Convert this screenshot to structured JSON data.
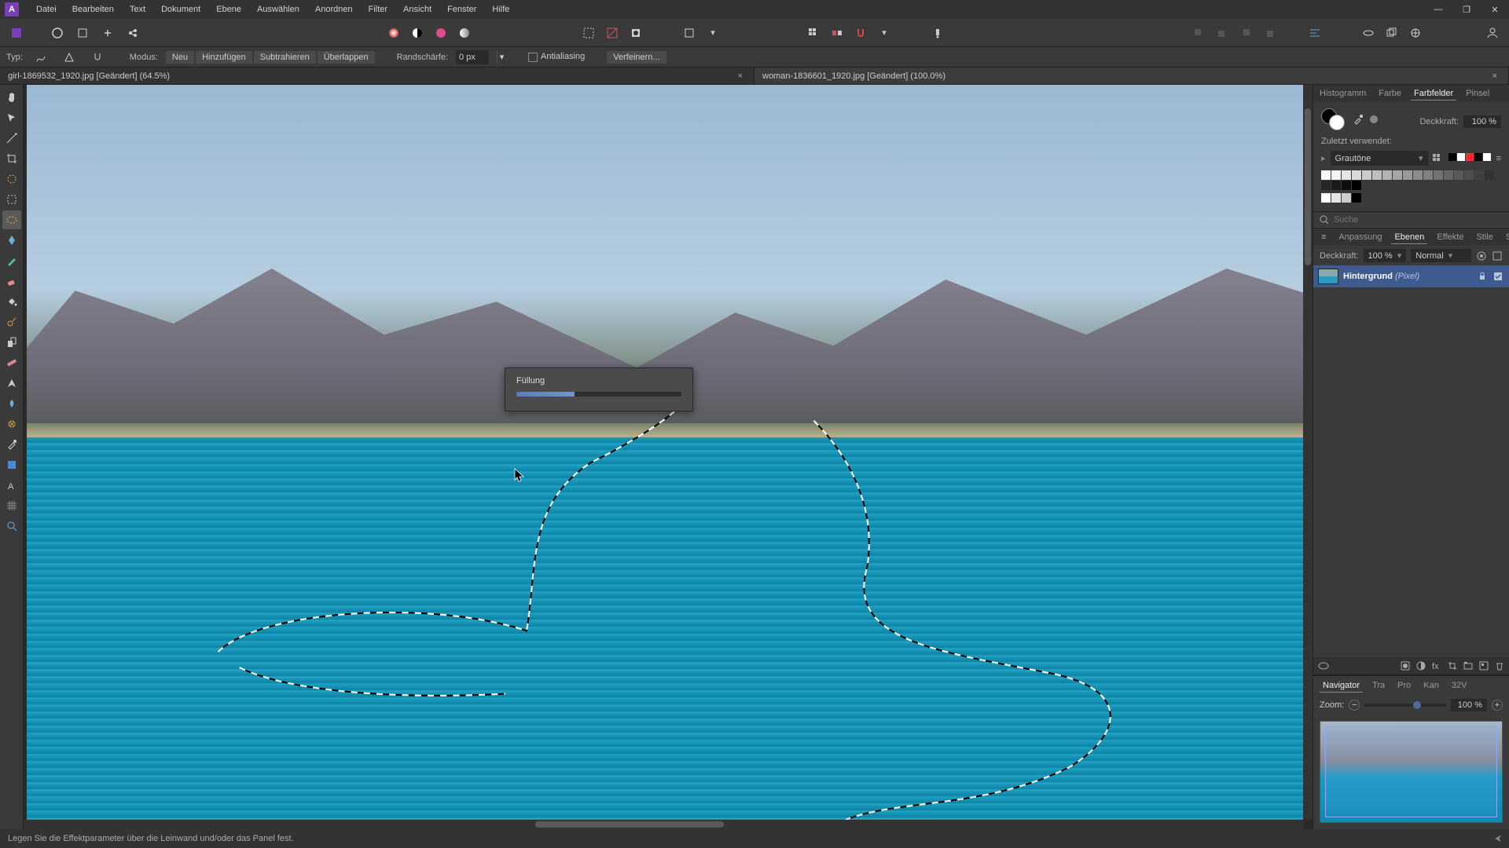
{
  "menu": [
    "Datei",
    "Bearbeiten",
    "Text",
    "Dokument",
    "Ebene",
    "Auswählen",
    "Anordnen",
    "Filter",
    "Ansicht",
    "Fenster",
    "Hilfe"
  ],
  "context": {
    "type_label": "Typ:",
    "mode_label": "Modus:",
    "modes": [
      "Neu",
      "Hinzufügen",
      "Subtrahieren",
      "Überlappen"
    ],
    "feather_label": "Randschärfe:",
    "feather_value": "0 px",
    "antialias": "Antialiasing",
    "refine": "Verfeinern..."
  },
  "tabs": [
    {
      "title": "girl-1869532_1920.jpg [Geändert] (64.5%)",
      "active": false
    },
    {
      "title": "woman-1836601_1920.jpg [Geändert] (100.0%)",
      "active": true
    }
  ],
  "progress": {
    "title": "Füllung"
  },
  "panels": {
    "top_tabs": [
      "Histogramm",
      "Farbe",
      "Farbfelder",
      "Pinsel"
    ],
    "top_active": "Farbfelder",
    "opacity_label": "Deckkraft:",
    "opacity_value": "100 %",
    "recent_label": "Zuletzt verwendet:",
    "palette_name": "Grautöne",
    "search_placeholder": "Suche",
    "mid_tabs": [
      "Anpassung",
      "Ebenen",
      "Effekte",
      "Stile",
      "Stock"
    ],
    "mid_active": "Ebenen",
    "layer_opacity_label": "Deckkraft:",
    "layer_opacity_value": "100 %",
    "blend_mode": "Normal",
    "layer_name": "Hintergrund",
    "layer_kind": "(Pixel)",
    "nav_tabs": [
      "Navigator",
      "Tra",
      "Pro",
      "Kan",
      "32V"
    ],
    "nav_active": "Navigator",
    "zoom_label": "Zoom:",
    "zoom_value": "100 %"
  },
  "statusbar": {
    "hint": "Legen Sie die Effektparameter über die Leinwand und/oder das Panel fest."
  },
  "gray_swatches": [
    "#ffffff",
    "#f2f2f2",
    "#e5e5e5",
    "#d9d9d9",
    "#cccccc",
    "#bfbfbf",
    "#b3b3b3",
    "#a6a6a6",
    "#999999",
    "#8c8c8c",
    "#808080",
    "#737373",
    "#666666",
    "#595959",
    "#4d4d4d",
    "#404040",
    "#333333",
    "#262626",
    "#1a1a1a",
    "#0d0d0d",
    "#000000"
  ],
  "recent_colors": [
    "#ffffff",
    "#e6e6e6",
    "#cccccc",
    "#000000"
  ],
  "palette_preview": [
    "#000000",
    "#ffffff",
    "#ff2a2a",
    "#000000",
    "#ffffff"
  ]
}
